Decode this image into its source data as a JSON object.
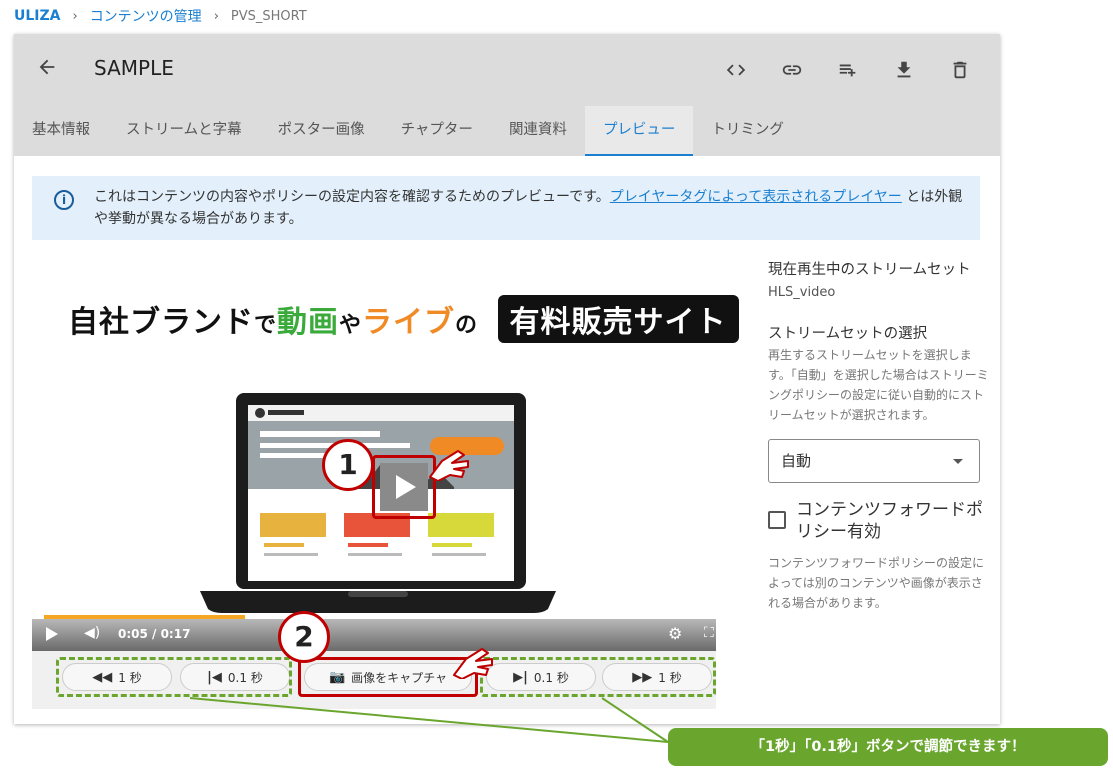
{
  "breadcrumb": {
    "root": "ULIZA",
    "section": "コンテンツの管理",
    "current": "PVS_SHORT",
    "separator": "›"
  },
  "header": {
    "back_icon": "arrow-left-icon",
    "title": "SAMPLE",
    "actions": [
      "code-icon",
      "link-icon",
      "playlist-add-icon",
      "download-icon",
      "delete-icon"
    ]
  },
  "tabs": [
    {
      "label": "基本情報",
      "active": false
    },
    {
      "label": "ストリームと字幕",
      "active": false
    },
    {
      "label": "ポスター画像",
      "active": false
    },
    {
      "label": "チャプター",
      "active": false
    },
    {
      "label": "関連資料",
      "active": false
    },
    {
      "label": "プレビュー",
      "active": true
    },
    {
      "label": "トリミング",
      "active": false
    }
  ],
  "info": {
    "text_before": "これはコンテンツの内容やポリシーの設定内容を確認するためのプレビューです。",
    "link": "プレイヤータグによって表示されるプレイヤー",
    "text_after": " とは外観や挙動が異なる場合があります。"
  },
  "video": {
    "banner_part1": "自社ブランド",
    "banner_part2": "で",
    "banner_part3": "動画",
    "banner_part4": "や",
    "banner_part5": "ライブ",
    "banner_part6": "の",
    "banner_badge": "有料販売サイト",
    "time": "0:05 / 0:17",
    "progress": 0.3
  },
  "buttons": {
    "back_1s": {
      "icon": "◀◀",
      "label": "1 秒"
    },
    "back_01s": {
      "icon": "|◀",
      "label": "0.1 秒"
    },
    "capture": {
      "icon": "camera-icon",
      "label": "画像をキャプチャ"
    },
    "fwd_01s": {
      "icon": "▶|",
      "label": "0.1 秒"
    },
    "fwd_1s": {
      "icon": "▶▶",
      "label": "1 秒"
    }
  },
  "annotations": {
    "step1": "1",
    "step2": "2",
    "callout": "「1秒」「0.1秒」ボタンで調節できます！"
  },
  "side": {
    "current_stream_label": "現在再生中のストリームセット",
    "current_stream_value": "HLS_video",
    "select_label": "ストリームセットの選択",
    "select_desc": "再生するストリームセットを選択します。「自動」を選択した場合はストリーミングポリシーの設定に従い自動的にストリームセットが選択されます。",
    "select_value": "自動",
    "checkbox_label": "コンテンツフォワードポリシー有効",
    "checkbox_desc": "コンテンツフォワードポリシーの設定によっては別のコンテンツや画像が表示される場合があります。"
  },
  "colors": {
    "accent": "#1a7fd0",
    "annotation_red": "#c00000",
    "annotation_green": "#6aa62e",
    "progress": "#f5a623"
  }
}
